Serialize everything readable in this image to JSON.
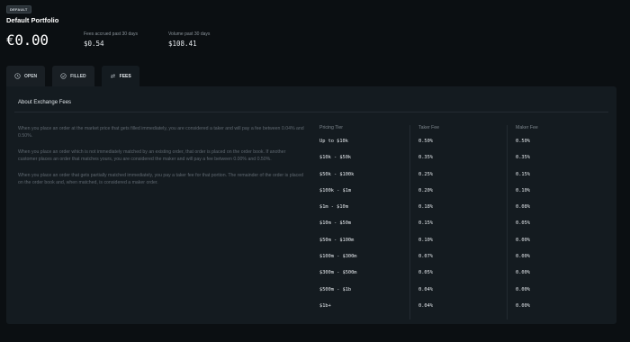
{
  "header": {
    "badge": "DEFAULT",
    "portfolio_name": "Default Portfolio",
    "balance": "€0.00",
    "fees_label": "Fees accrued past 30 days",
    "fees_value": "$0.54",
    "volume_label": "Volume past 30 days",
    "volume_value": "$108.41"
  },
  "tabs": [
    {
      "label": "OPEN",
      "icon": "clock-icon"
    },
    {
      "label": "FILLED",
      "icon": "check-circle-icon"
    },
    {
      "label": "FEES",
      "icon": "swap-arrows-icon",
      "active": true
    }
  ],
  "panel": {
    "title": "About Exchange Fees",
    "paragraphs": [
      "When you place an order at the market price that gets filled immediately, you are considered a taker and will pay a fee between 0.04% and 0.50%.",
      "When you place an order which is not immediately matched by an existing order, that order is placed on the order book. If another customer places an order that matches yours, you are considered the maker and will pay a fee between 0.00% and 0.50%.",
      "When you place an order that gets partially matched immediately, you pay a taker fee for that portion. The remainder of the order is placed on the order book and, when matched, is considered a maker order."
    ]
  },
  "fee_table": {
    "headers": [
      "Pricing Tier",
      "Taker Fee",
      "Maker Fee"
    ],
    "rows": [
      [
        "Up to $10k",
        "0.50%",
        "0.50%"
      ],
      [
        "$10k - $50k",
        "0.35%",
        "0.35%"
      ],
      [
        "$50k - $100k",
        "0.25%",
        "0.15%"
      ],
      [
        "$100k - $1m",
        "0.20%",
        "0.10%"
      ],
      [
        "$1m - $10m",
        "0.18%",
        "0.08%"
      ],
      [
        "$10m - $50m",
        "0.15%",
        "0.05%"
      ],
      [
        "$50m - $100m",
        "0.10%",
        "0.00%"
      ],
      [
        "$100m - $300m",
        "0.07%",
        "0.00%"
      ],
      [
        "$300m - $500m",
        "0.05%",
        "0.00%"
      ],
      [
        "$500m - $1b",
        "0.04%",
        "0.00%"
      ],
      [
        "$1b+",
        "0.04%",
        "0.00%"
      ]
    ]
  }
}
